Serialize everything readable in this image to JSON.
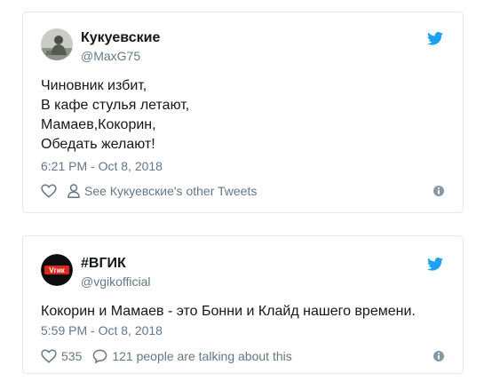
{
  "tweets": [
    {
      "display_name": "Кукуевские",
      "handle": "@MaxG75",
      "avatar_icon": "avatar-photo-icon",
      "body_lines": [
        "Чиновник избит,",
        "В кафе стулья летают,",
        "Мамаев,Кокорин,",
        "Обедать желают!"
      ],
      "timestamp": "6:21 PM - Oct 8, 2018",
      "like_icon": "heart-icon",
      "like_count": "",
      "secondary_icon": "person-icon",
      "secondary_label": "See Кукуевские's other Tweets",
      "info_icon": "info-icon"
    },
    {
      "display_name": "#ВГИК",
      "handle": "@vgikofficial",
      "avatar_icon": "vgik-logo-icon",
      "avatar_text": "Vгик",
      "body_lines": [
        "Кокорин и Мамаев - это Бонни и Клайд нашего времени."
      ],
      "timestamp": "5:59 PM - Oct 8, 2018",
      "like_icon": "heart-icon",
      "like_count": "535",
      "secondary_icon": "speech-bubble-icon",
      "secondary_label": "121 people are talking about this",
      "info_icon": "info-icon"
    }
  ],
  "colors": {
    "twitter_blue": "#1da1f2",
    "text_primary": "#14171a",
    "text_secondary": "#657786",
    "border": "#e1e8ed",
    "vgik_red": "#e0261b"
  }
}
